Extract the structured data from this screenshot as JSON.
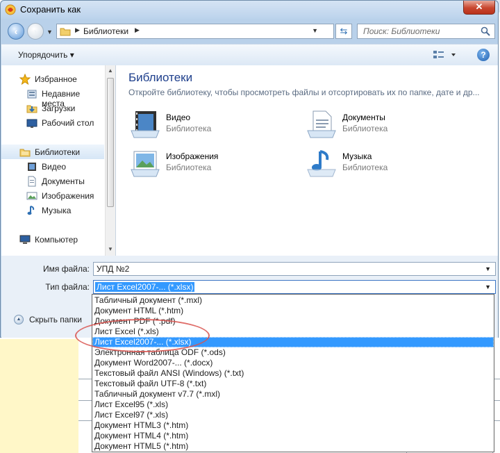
{
  "window": {
    "title": "Сохранить как",
    "close_label": "✕"
  },
  "address_bar": {
    "path": [
      "Библиотеки"
    ]
  },
  "search": {
    "placeholder": "Поиск: Библиотеки"
  },
  "toolbar": {
    "organize_label": "Упорядочить ▾",
    "help_label": "?"
  },
  "sidebar": {
    "items": [
      {
        "label": "Избранное",
        "icon": "star-icon"
      },
      {
        "label": "Недавние места",
        "icon": "recent-places-icon"
      },
      {
        "label": "Загрузки",
        "icon": "downloads-icon"
      },
      {
        "label": "Рабочий стол",
        "icon": "desktop-icon"
      },
      {
        "label": "Библиотеки",
        "icon": "libraries-icon",
        "selected": true
      },
      {
        "label": "Видео",
        "icon": "video-icon"
      },
      {
        "label": "Документы",
        "icon": "documents-icon"
      },
      {
        "label": "Изображения",
        "icon": "pictures-icon"
      },
      {
        "label": "Музыка",
        "icon": "music-icon"
      },
      {
        "label": "Компьютер",
        "icon": "computer-icon"
      }
    ]
  },
  "content": {
    "title": "Библиотеки",
    "subtitle": "Откройте библиотеку, чтобы просмотреть файлы и отсортировать их по папке, дате и др...",
    "libraries": [
      {
        "name": "Видео",
        "type": "Библиотека",
        "icon": "video-library-icon"
      },
      {
        "name": "Документы",
        "type": "Библиотека",
        "icon": "documents-library-icon"
      },
      {
        "name": "Изображения",
        "type": "Библиотека",
        "icon": "pictures-library-icon"
      },
      {
        "name": "Музыка",
        "type": "Библиотека",
        "icon": "music-library-icon"
      }
    ]
  },
  "form": {
    "filename_label": "Имя файла:",
    "filename_value": "УПД №2",
    "filetype_label": "Тип файла:",
    "filetype_value": "Лист Excel2007-... (*.xlsx)",
    "hide_folders_label": "Скрыть папки"
  },
  "filetype_options": [
    "Табличный документ (*.mxl)",
    "Документ HTML (*.htm)",
    "Документ PDF (*.pdf)",
    "Лист Excel (*.xls)",
    "Лист Excel2007-... (*.xlsx)",
    "Электронная таблица ODF (*.ods)",
    "Документ Word2007-... (*.docx)",
    "Текстовый файл ANSI (Windows) (*.txt)",
    "Текстовый файл UTF-8 (*.txt)",
    "Табличный документ v7.7 (*.mxl)",
    "Лист Excel95 (*.xls)",
    "Лист Excel97 (*.xls)",
    "Документ HTML3 (*.htm)",
    "Документ HTML4 (*.htm)",
    "Документ HTML5 (*.htm)"
  ],
  "selected_option_index": 4,
  "colors": {
    "selection": "#3399ff",
    "annotation": "#d9534f",
    "title_blue": "#1e3f8c"
  }
}
